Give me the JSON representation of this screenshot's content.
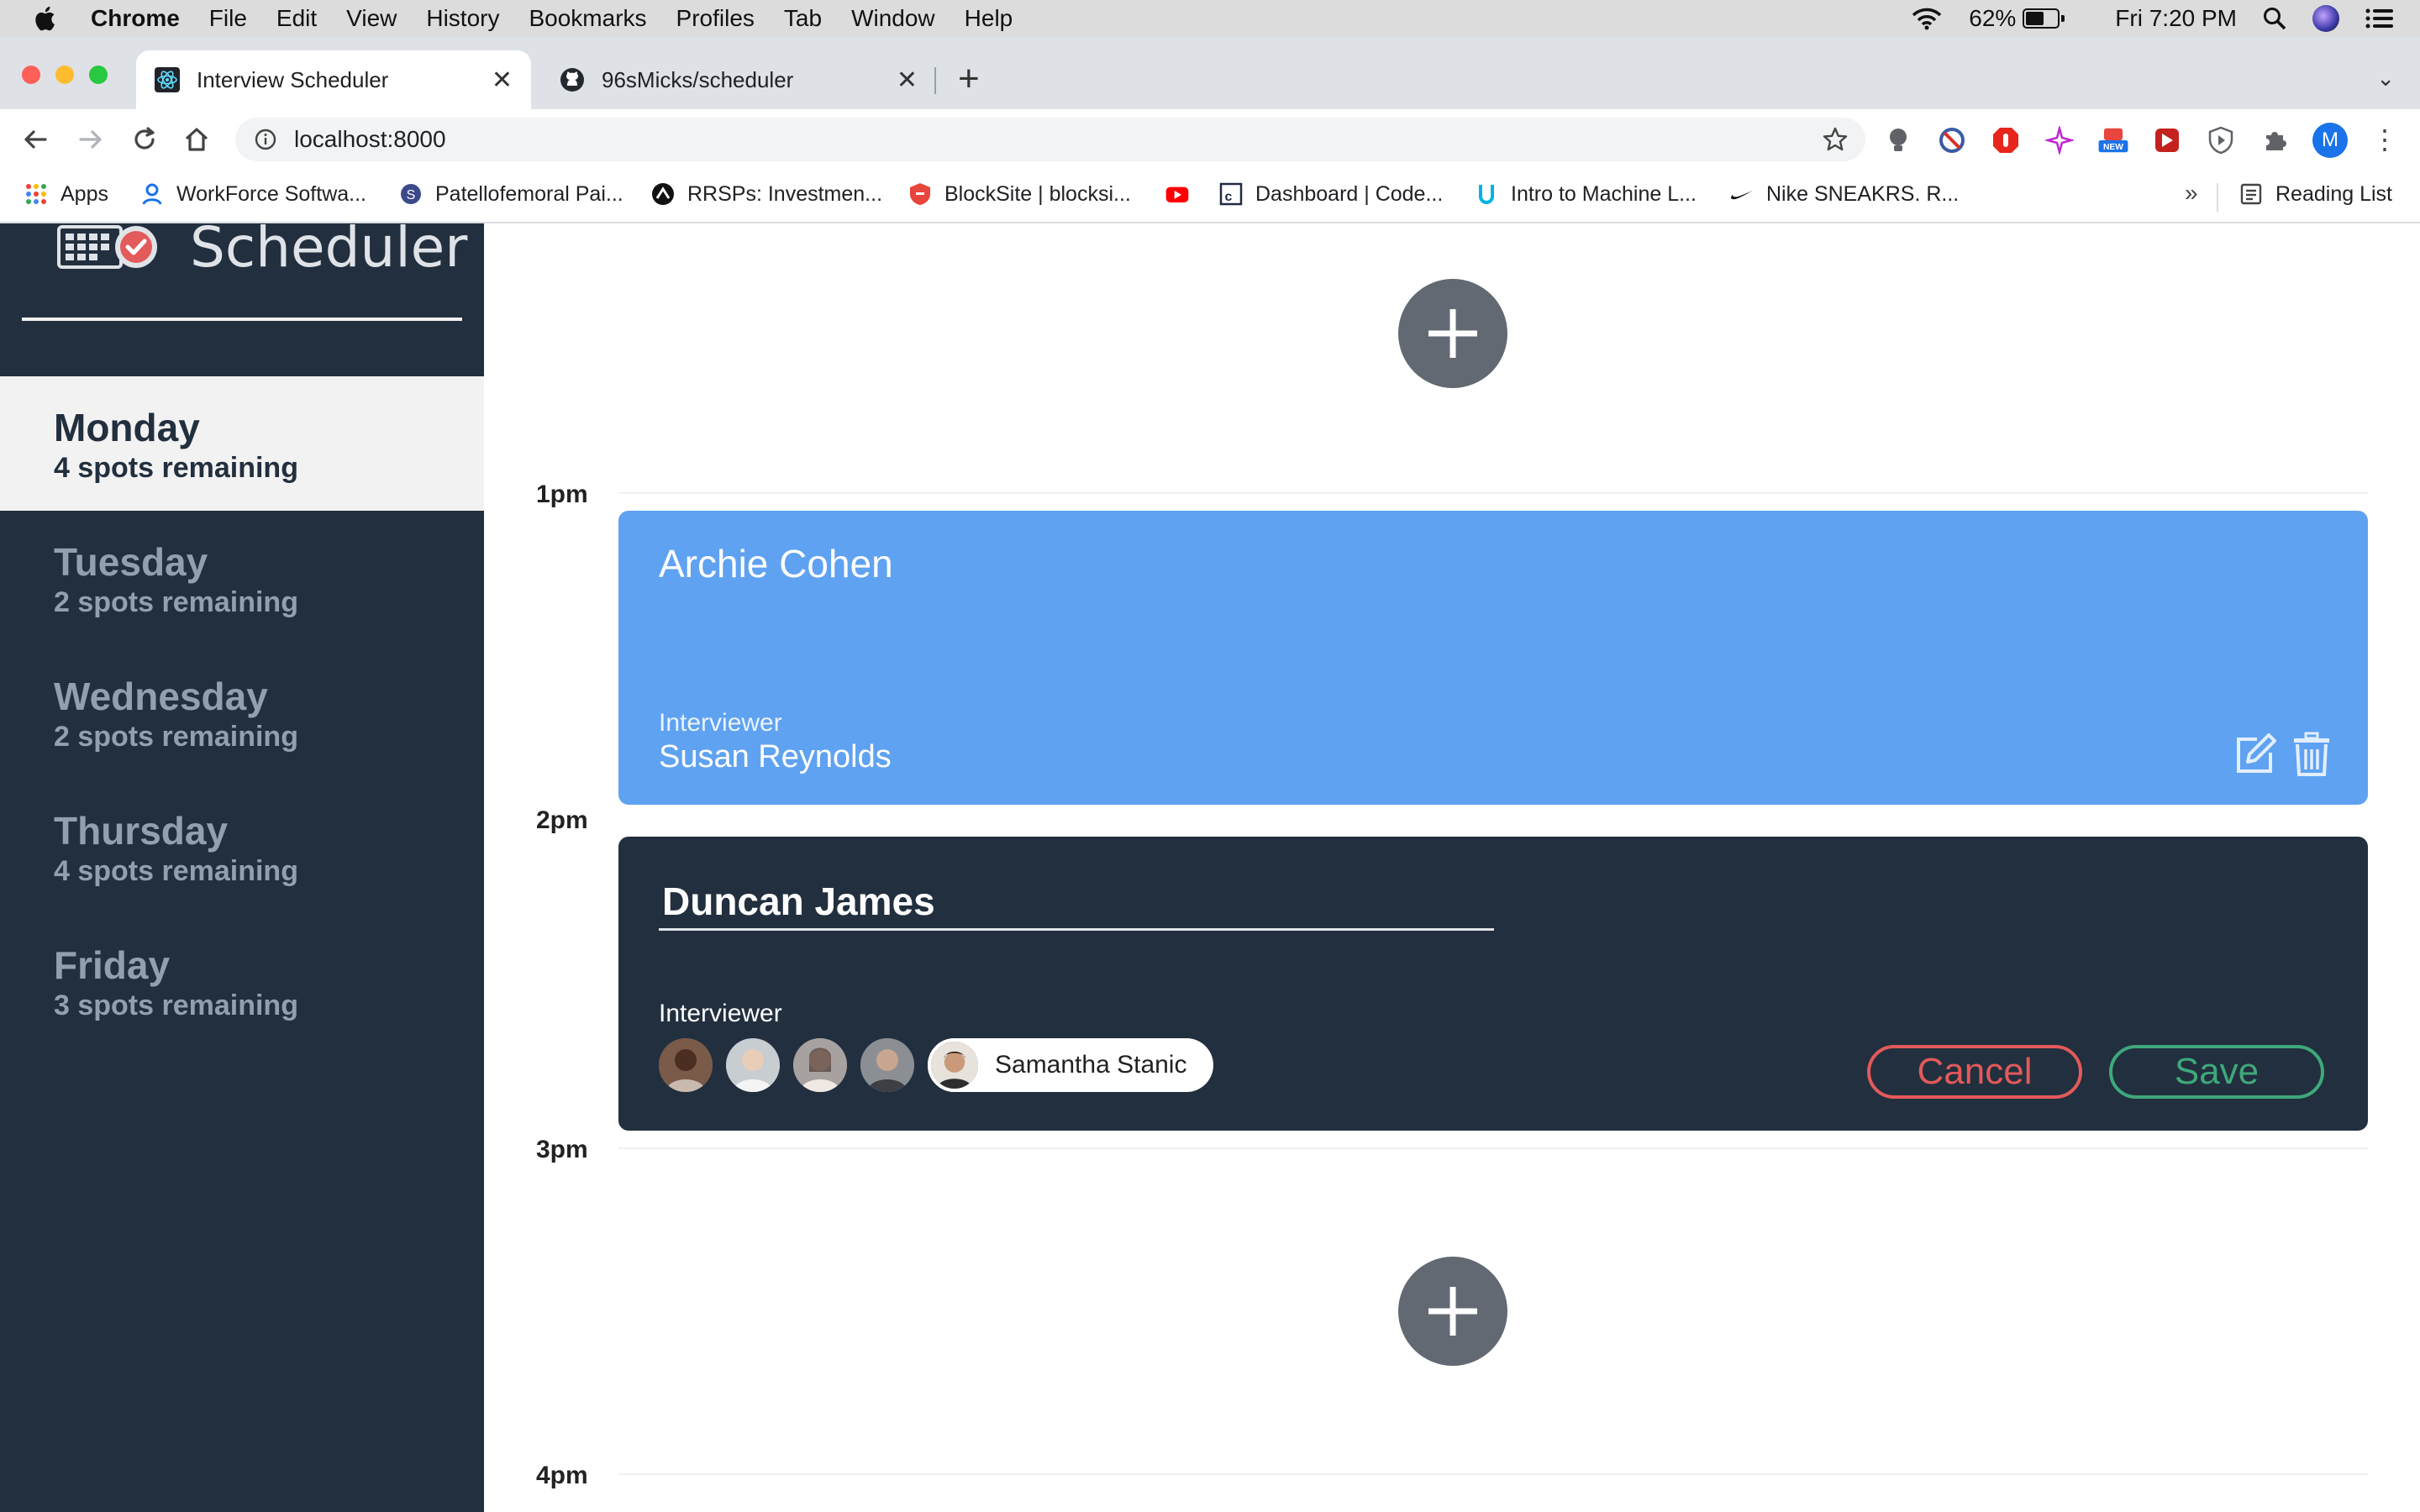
{
  "menubar": {
    "app": "Chrome",
    "items": [
      "File",
      "Edit",
      "View",
      "History",
      "Bookmarks",
      "Profiles",
      "Tab",
      "Window",
      "Help"
    ],
    "battery": "62%",
    "battery_level": 0.62,
    "clock": "Fri 7:20 PM"
  },
  "tabs": [
    {
      "title": "Interview Scheduler",
      "active": true
    },
    {
      "title": "96sMicks/scheduler",
      "active": false
    }
  ],
  "address": {
    "url": "localhost:8000"
  },
  "profile_initial": "M",
  "bookmarks": {
    "apps": "Apps",
    "items": [
      "WorkForce Softwa...",
      "Patellofemoral Pai...",
      "RRSPs: Investmen...",
      "BlockSite | blocksi...",
      "",
      "Dashboard | Code...",
      "Intro to Machine L...",
      "Nike SNEAKRS. R..."
    ],
    "more": "»",
    "reading_list": "Reading List"
  },
  "sidebar": {
    "logo_text": "Scheduler",
    "days": [
      {
        "name": "Monday",
        "spots": "4 spots remaining",
        "selected": true
      },
      {
        "name": "Tuesday",
        "spots": "2 spots remaining",
        "selected": false
      },
      {
        "name": "Wednesday",
        "spots": "2 spots remaining",
        "selected": false
      },
      {
        "name": "Thursday",
        "spots": "4 spots remaining",
        "selected": false
      },
      {
        "name": "Friday",
        "spots": "3 spots remaining",
        "selected": false
      }
    ]
  },
  "schedule": {
    "times": [
      "1pm",
      "2pm",
      "3pm",
      "4pm"
    ],
    "show_card": {
      "student": "Archie Cohen",
      "interviewer_label": "Interviewer",
      "interviewer": "Susan Reynolds"
    },
    "form_card": {
      "student_value": "Duncan James",
      "interviewer_label": "Interviewer",
      "selected_interviewer": "Samantha Stanic",
      "cancel_label": "Cancel",
      "save_label": "Save"
    }
  },
  "colors": {
    "sidebar_bg": "#222f3e",
    "show_card_bg": "#5fa2f1",
    "cancel": "#e25a5a",
    "save": "#3ea87a",
    "add_button": "#626972"
  }
}
